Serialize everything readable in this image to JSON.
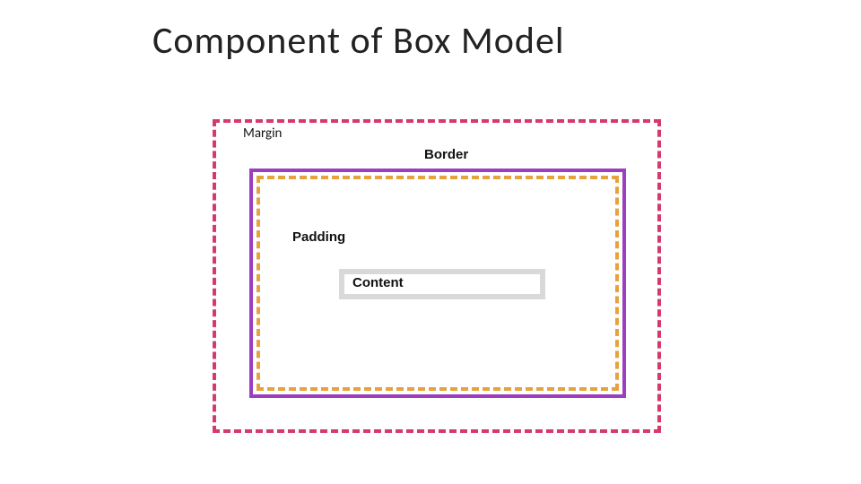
{
  "title": "Component of Box Model",
  "labels": {
    "margin": "Margin",
    "border": "Border",
    "padding": "Padding",
    "content": "Content"
  }
}
